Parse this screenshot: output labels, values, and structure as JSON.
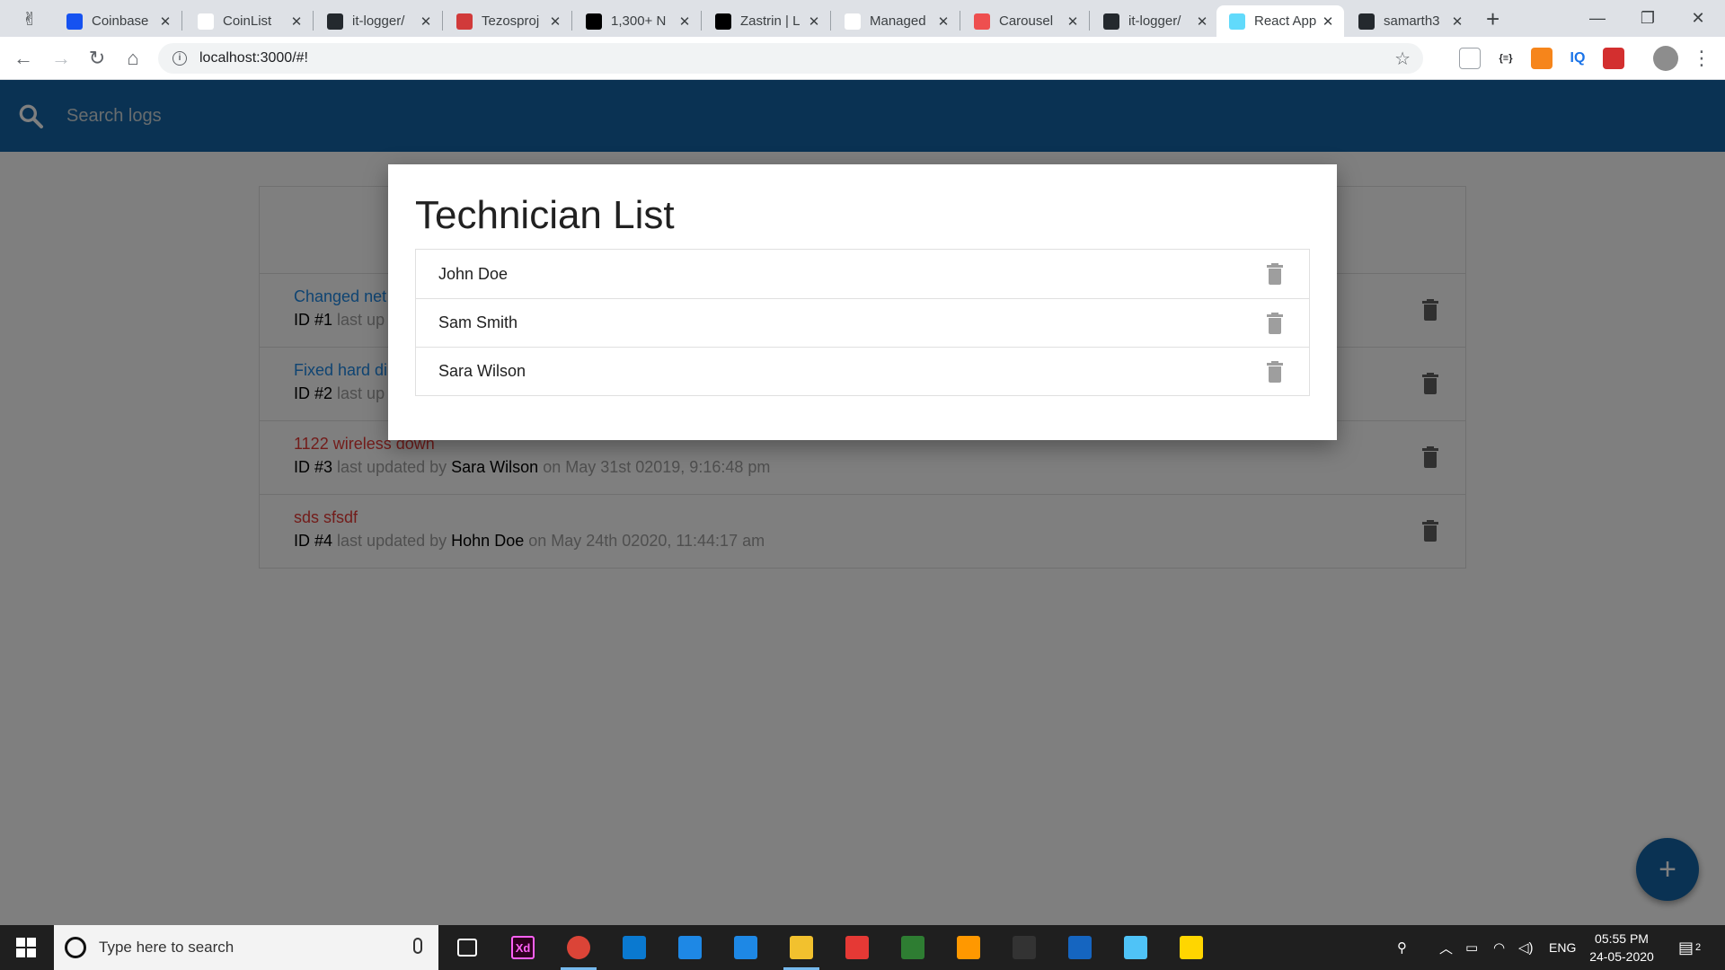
{
  "browser": {
    "tabs": [
      {
        "label": "",
        "favicon": "app-icon",
        "color": "#dee1e6"
      },
      {
        "label": "Coinbase",
        "favicon": "coinbase-icon",
        "color": "#1652f0"
      },
      {
        "label": "CoinList",
        "favicon": "coinlist-icon",
        "color": "#ffffff"
      },
      {
        "label": "it-logger/",
        "favicon": "github-icon",
        "color": "#24292e"
      },
      {
        "label": "Tezosproj",
        "favicon": "tezos-icon",
        "color": "#d13a3a"
      },
      {
        "label": "1,300+ N",
        "favicon": "medium-icon",
        "color": "#000000"
      },
      {
        "label": "Zastrin | L",
        "favicon": "zastrin-icon",
        "color": "#000000"
      },
      {
        "label": "Managed",
        "favicon": "managed-icon",
        "color": "#ffffff"
      },
      {
        "label": "Carousel",
        "favicon": "carousel-icon",
        "color": "#ee4f4f"
      },
      {
        "label": "it-logger/",
        "favicon": "github-icon",
        "color": "#24292e"
      },
      {
        "label": "React App",
        "favicon": "react-icon",
        "color": "#61dafb",
        "active": true
      },
      {
        "label": "samarth3",
        "favicon": "github-icon",
        "color": "#24292e"
      }
    ],
    "url": "localhost:3000/#!"
  },
  "app": {
    "search_placeholder": "Search logs",
    "logs": [
      {
        "message": "Changed net",
        "id_label": "ID #1",
        "meta": "last up",
        "tech": "",
        "date": "",
        "attention": false
      },
      {
        "message": "Fixed hard di",
        "id_label": "ID #2",
        "meta": "last up",
        "tech": "",
        "date": "",
        "attention": false
      },
      {
        "message": "1122 wireless down",
        "id_label": "ID #3",
        "meta": "last updated by",
        "tech": "Sara Wilson",
        "date": "on May 31st 02019, 9:16:48 pm",
        "attention": true
      },
      {
        "message": "sds sfsdf",
        "id_label": "ID #4",
        "meta": "last updated by",
        "tech": "Hohn Doe",
        "date": "on May 24th 02020, 11:44:17 am",
        "attention": true
      }
    ],
    "fab_label": "+"
  },
  "modal": {
    "title": "Technician List",
    "technicians": [
      "John Doe",
      "Sam Smith",
      "Sara Wilson"
    ]
  },
  "taskbar": {
    "search_placeholder": "Type here to search",
    "apps": [
      {
        "name": "task-view-icon",
        "color": "#1f1f1f",
        "text": ""
      },
      {
        "name": "adobe-xd-icon",
        "color": "#2e001f",
        "text": "Xd"
      },
      {
        "name": "chrome-icon",
        "color": "#db4437",
        "text": "",
        "active": true
      },
      {
        "name": "vscode-icon",
        "color": "#0a79d0",
        "text": ""
      },
      {
        "name": "settings-app-icon",
        "color": "#1e88e5",
        "text": ""
      },
      {
        "name": "safari-icon",
        "color": "#1e88e5",
        "text": ""
      },
      {
        "name": "file-explorer-icon",
        "color": "#f2c12e",
        "text": "",
        "active": true
      },
      {
        "name": "git-icon",
        "color": "#e53935",
        "text": ""
      },
      {
        "name": "maps-icon",
        "color": "#2e7d32",
        "text": ""
      },
      {
        "name": "sublime-icon",
        "color": "#ff9800",
        "text": ""
      },
      {
        "name": "terminal-icon",
        "color": "#333333",
        "text": ""
      },
      {
        "name": "outlook-icon",
        "color": "#1565c0",
        "text": ""
      },
      {
        "name": "azure-icon",
        "color": "#4fc3f7",
        "text": ""
      },
      {
        "name": "sticky-notes-icon",
        "color": "#ffd600",
        "text": ""
      }
    ],
    "language": "ENG",
    "time": "05:55 PM",
    "date": "24-05-2020",
    "notification_count": "2"
  }
}
